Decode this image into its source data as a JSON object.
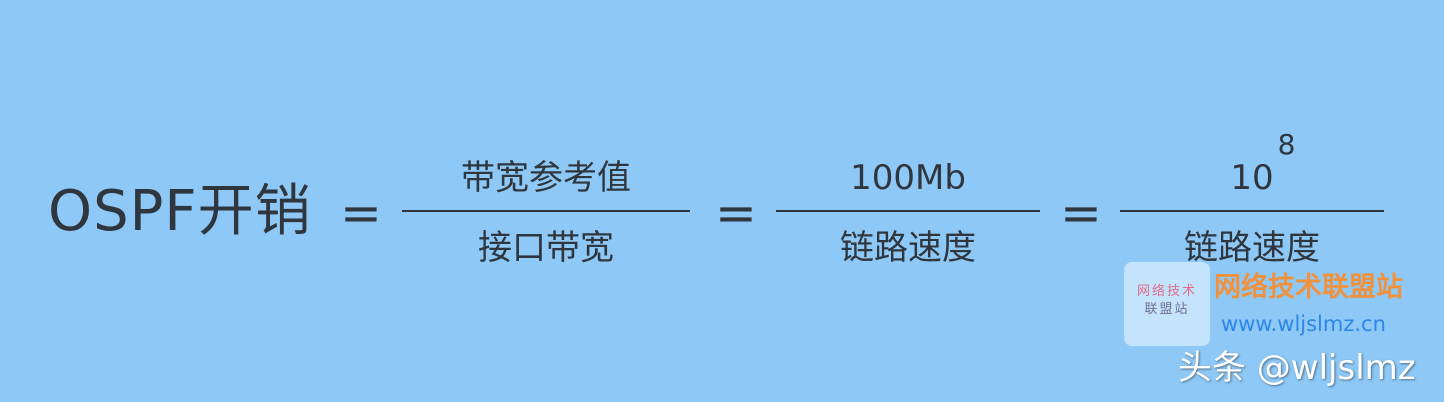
{
  "formula": {
    "lhs": "OSPF开销",
    "equals_symbol": "=",
    "fraction1": {
      "numerator": "带宽参考值",
      "denominator": "接口带宽"
    },
    "fraction2": {
      "numerator": "100Mb",
      "denominator": "链路速度"
    },
    "fraction3": {
      "numerator_base": "10",
      "numerator_exponent": "8",
      "denominator": "链路速度"
    }
  },
  "branding": {
    "logo_line1": "网络技术",
    "logo_line2": "联盟站",
    "name": "网络技术联盟站",
    "url": "www.wljslmz.cn",
    "watermark": "头条 @wljslmz"
  },
  "colors": {
    "background": "#8ec8f6",
    "text": "#2f363d",
    "brand_orange": "#f0923d",
    "brand_blue": "#2d86ea",
    "watermark": "#ffffff"
  }
}
